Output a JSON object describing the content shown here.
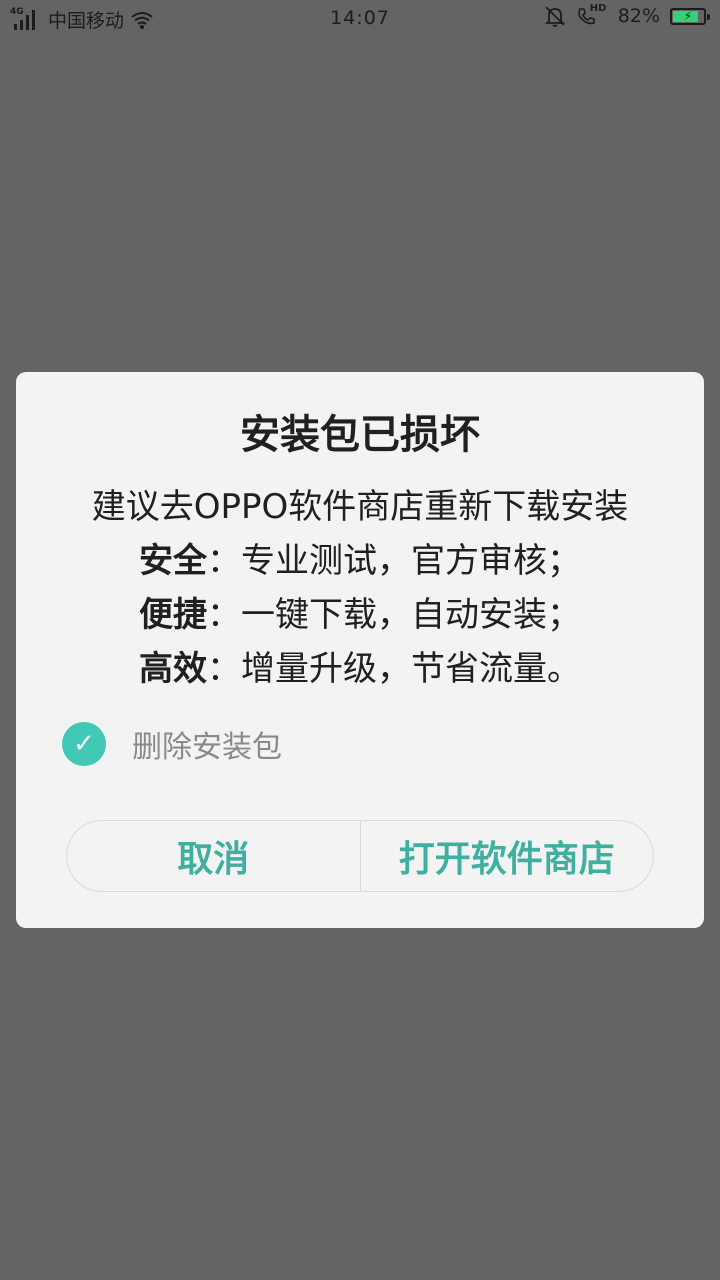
{
  "status_bar": {
    "network_type": "4G",
    "carrier": "中国移动",
    "time": "14:07",
    "hd_label": "HD",
    "battery_percent": "82%",
    "battery_level": 0.82
  },
  "dialog": {
    "title": "安装包已损坏",
    "lines": [
      {
        "text": "建议去OPPO软件商店重新下载安装"
      },
      {
        "label": "安全",
        "text": "：专业测试，官方审核；"
      },
      {
        "label": "便捷",
        "text": "：一键下载，自动安装；"
      },
      {
        "label": "高效",
        "text": "：增量升级，节省流量。"
      }
    ],
    "checkbox": {
      "label": "删除安装包",
      "checked": true
    },
    "cancel_label": "取消",
    "open_store_label": "打开软件商店"
  },
  "colors": {
    "accent": "#41c9b5",
    "button_text": "#3fb0a0",
    "battery_fill": "#33d17a",
    "overlay": "#646464"
  }
}
